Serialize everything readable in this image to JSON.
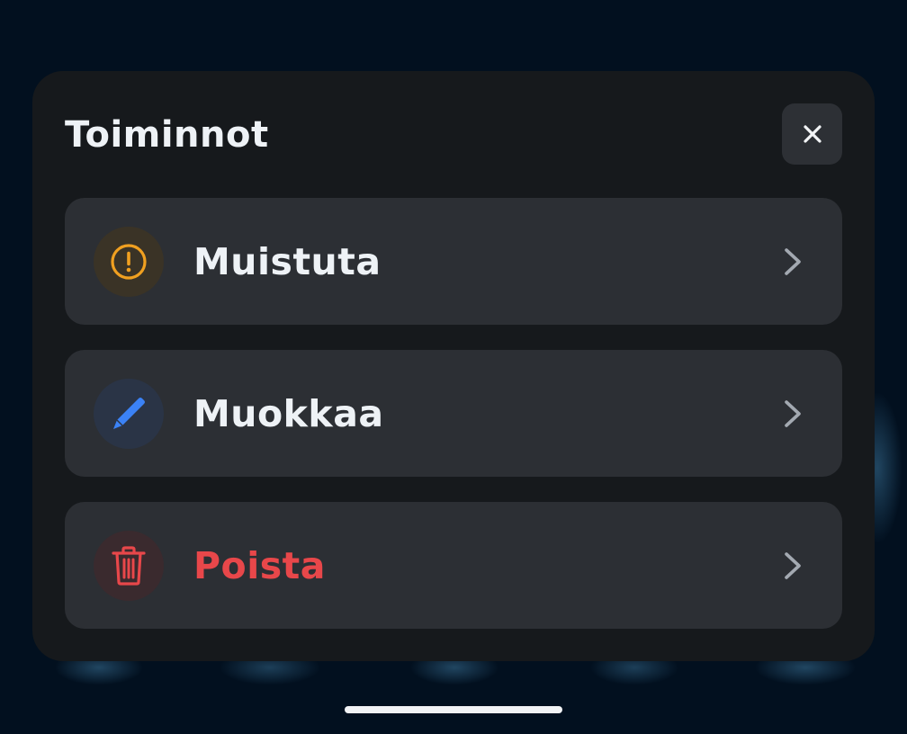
{
  "sheet": {
    "title": "Toiminnot",
    "close_icon": "close-icon"
  },
  "actions": [
    {
      "label": "Muistuta",
      "icon": "alert-circle-icon",
      "color": "#f0a020"
    },
    {
      "label": "Muokkaa",
      "icon": "pencil-icon",
      "color": "#3b82f6"
    },
    {
      "label": "Poista",
      "icon": "trash-icon",
      "color": "#e8474a"
    }
  ],
  "colors": {
    "background": "#02101f",
    "sheet": "#16191c",
    "item": "#2c2f34",
    "text": "#eef2f6",
    "danger": "#e8474a"
  }
}
